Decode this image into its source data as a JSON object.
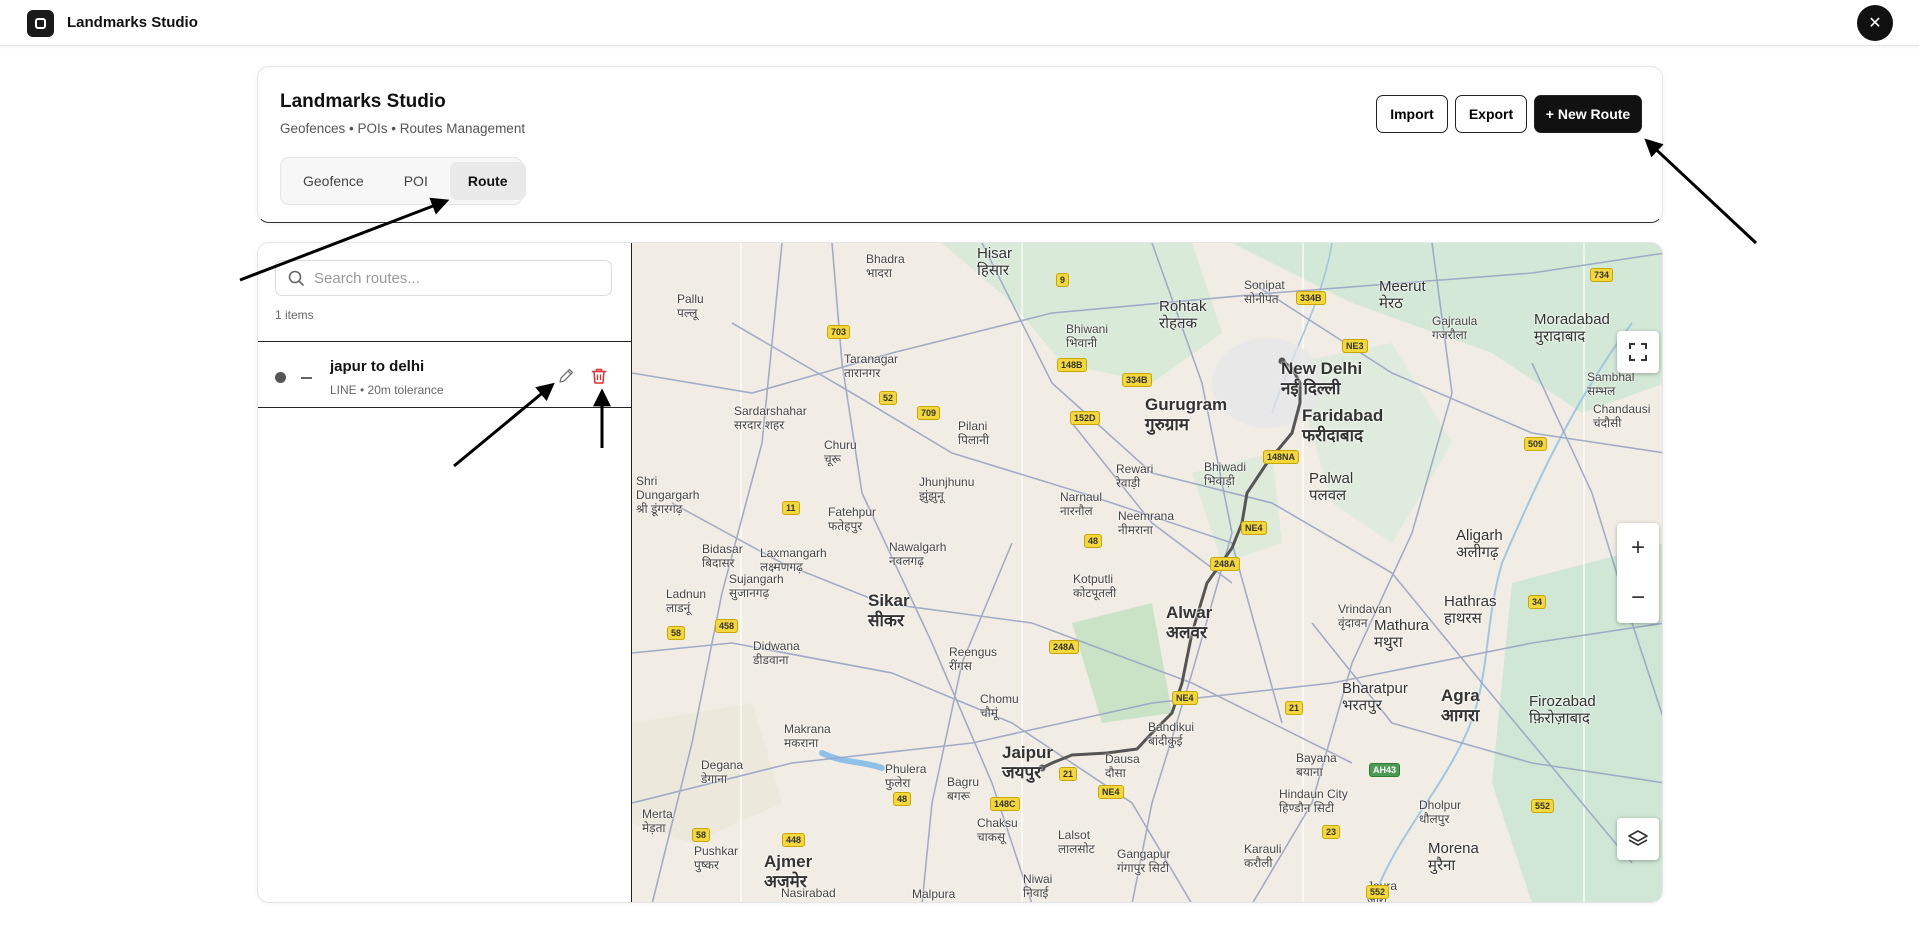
{
  "topbar": {
    "title": "Landmarks Studio",
    "close": "✕"
  },
  "header": {
    "title": "Landmarks Studio",
    "subtitle": "Geofences • POIs • Routes Management",
    "tabs": [
      {
        "label": "Geofence",
        "active": false
      },
      {
        "label": "POI",
        "active": false
      },
      {
        "label": "Route",
        "active": true
      }
    ],
    "actions": {
      "import": "Import",
      "export": "Export",
      "new_route": "+ New Route"
    }
  },
  "sidebar": {
    "search_placeholder": "Search routes...",
    "count": "1 items",
    "routes": [
      {
        "name": "japur to delhi",
        "meta": "LINE • 20m tolerance"
      }
    ]
  },
  "map": {
    "places": {
      "hisar": "Hisar\nहिसार",
      "bhadra": "Bhadra\nभादरा",
      "pallu": "Pallu\nपल्लू",
      "rohtak": "Rohtak\nरोहतक",
      "sonipat": "Sonipat\nसोनीपत",
      "meerut": "Meerut\nमेरठ",
      "moradabad": "Moradabad\nमुरादाबाद",
      "bhiwani": "Bhiwani\nभिवानी",
      "taranagar": "Taranagar\nतारानगर",
      "new_delhi": "New Delhi\nनई दिल्ली",
      "gurugram": "Gurugram\nगुरुग्राम",
      "faridabad": "Faridabad\nफरीदाबाद",
      "sardarshahar": "Sardarshahar\nसरदार शहर",
      "churu": "Churu\nचूरू",
      "pilani": "Pilani\nपिलानी",
      "rewari": "Rewari\nरेवाड़ी",
      "bhiwadi": "Bhiwadi\nभिवाड़ी",
      "palwal": "Palwal\nपलवल",
      "jhunjhunu": "Jhunjhunu\nझुंझुनू",
      "fatehpur": "Fatehpur\nफतेहपुर",
      "narnaul": "Narnaul\nनारनौल",
      "neemrana": "Neemrana\nनीमराना",
      "aligarh": "Aligarh\nअलीगढ़",
      "shri_dungargarh": "Shri\nDungargarh\nश्री डूंगरगढ़",
      "bidasar": "Bidasar\nबिदासर",
      "laxmangarh": "Laxmangarh\nलक्ष्मणगढ़",
      "nawalgarh": "Nawalgarh\nनवलगढ़",
      "sujangarh": "Sujangarh\nसुजानगढ़",
      "kotputli": "Kotputli\nकोटपूतली",
      "alwar": "Alwar\nअलवर",
      "hathras": "Hathras\nहाथरस",
      "ladnun": "Ladnun\nलाडनूं",
      "sikar": "Sikar\nसीकर",
      "vrindavan": "Vrindavan\nवृंदावन",
      "mathura": "Mathura\nमथुरा",
      "didwana": "Didwana\nडीडवाना",
      "reengus": "Reengus\nरींगस",
      "bharatpur": "Bharatpur\nभरतपुर",
      "agra": "Agra\nआगरा",
      "firozabad": "Firozabad\nफ़िरोज़ाबाद",
      "chomu": "Chomu\nचौमूं",
      "makrana": "Makrana\nमकराना",
      "jaipur": "Jaipur\nजयपुर",
      "bandikui": "Bandikui\nबांदीकुई",
      "dausa": "Dausa\nदौसा",
      "bayana": "Bayana\nबयाना",
      "degana": "Degana\nडेगाना",
      "phulera": "Phulera\nफुलेरा",
      "bagru": "Bagru\nबगरू",
      "hindaun": "Hindaun City\nहिण्डौन सिटी",
      "dholpur": "Dholpur\nधौलपुर",
      "merta": "Merta\nमेड़ता",
      "chaksu": "Chaksu\nचाकसू",
      "lalsot": "Lalsot\nलालसोट",
      "gangapur": "Gangapur\nगंगापुर सिटी",
      "karauli": "Karauli\nकरौली",
      "morena": "Morena\nमुरैना",
      "pushkar": "Pushkar\nपुष्कर",
      "ajmer": "Ajmer\nअजमेर",
      "niwai": "Niwai\nनिवाई",
      "nasirabad": "Nasirabad",
      "malpura": "Malpura",
      "joura": "Joura\nजौरा",
      "sambhal": "Sambhal\nसम्भल",
      "chandausi": "Chandausi\nचंदौसी",
      "gajraula": "Gajraula\nगजरौला"
    },
    "shields": [
      "9",
      "334B",
      "703",
      "NE3",
      "734",
      "148B",
      "334B",
      "52",
      "709",
      "152D",
      "148NA",
      "509",
      "11",
      "48",
      "NE4",
      "248A",
      "458",
      "58",
      "248A",
      "NE4",
      "21",
      "34",
      "21",
      "NE4",
      "148C",
      "48",
      "AH43",
      "552",
      "448",
      "58",
      "23",
      "552"
    ]
  },
  "colors": {
    "accent": "#111111",
    "delete": "#e03131",
    "route_line": "#555555",
    "map_bg": "#f1ede4"
  }
}
